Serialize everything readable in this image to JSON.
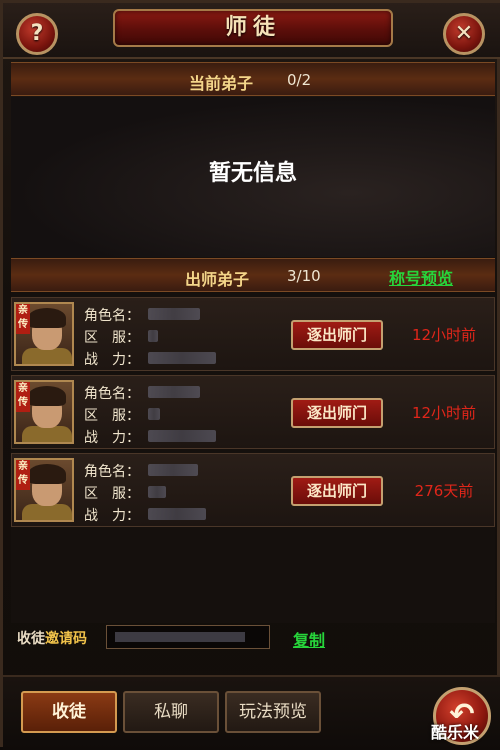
{
  "window": {
    "title": "师徒",
    "help_icon": "?",
    "close_icon": "✕"
  },
  "current_disciples": {
    "label": "当前弟子",
    "count": "0/2",
    "empty_message": "暂无信息"
  },
  "graduated_disciples": {
    "label": "出师弟子",
    "count": "3/10",
    "title_preview_link": "称号预览",
    "rows": [
      {
        "badge": "亲传",
        "name_label": "角色名：",
        "server_label": "区　服：",
        "power_label": "战　力：",
        "expel_button": "逐出师门",
        "time_ago": "12小时前"
      },
      {
        "badge": "亲传",
        "name_label": "角色名：",
        "server_label": "区　服：",
        "power_label": "战　力：",
        "expel_button": "逐出师门",
        "time_ago": "12小时前"
      },
      {
        "badge": "亲传",
        "name_label": "角色名：",
        "server_label": "区　服：",
        "power_label": "战　力：",
        "expel_button": "逐出师门",
        "time_ago": "276天前"
      }
    ]
  },
  "invite": {
    "label_prefix": "收徒",
    "label_suffix": "邀请码",
    "copy_link": "复制"
  },
  "bottom_tabs": {
    "recruit": "收徒",
    "private_chat": "私聊",
    "gameplay_preview": "玩法预览",
    "back_icon": "↶"
  },
  "watermark": "酷乐米",
  "colors": {
    "accent_green": "#27d53b",
    "time_red": "#e0261a",
    "header_gold": "#f4d68a"
  }
}
